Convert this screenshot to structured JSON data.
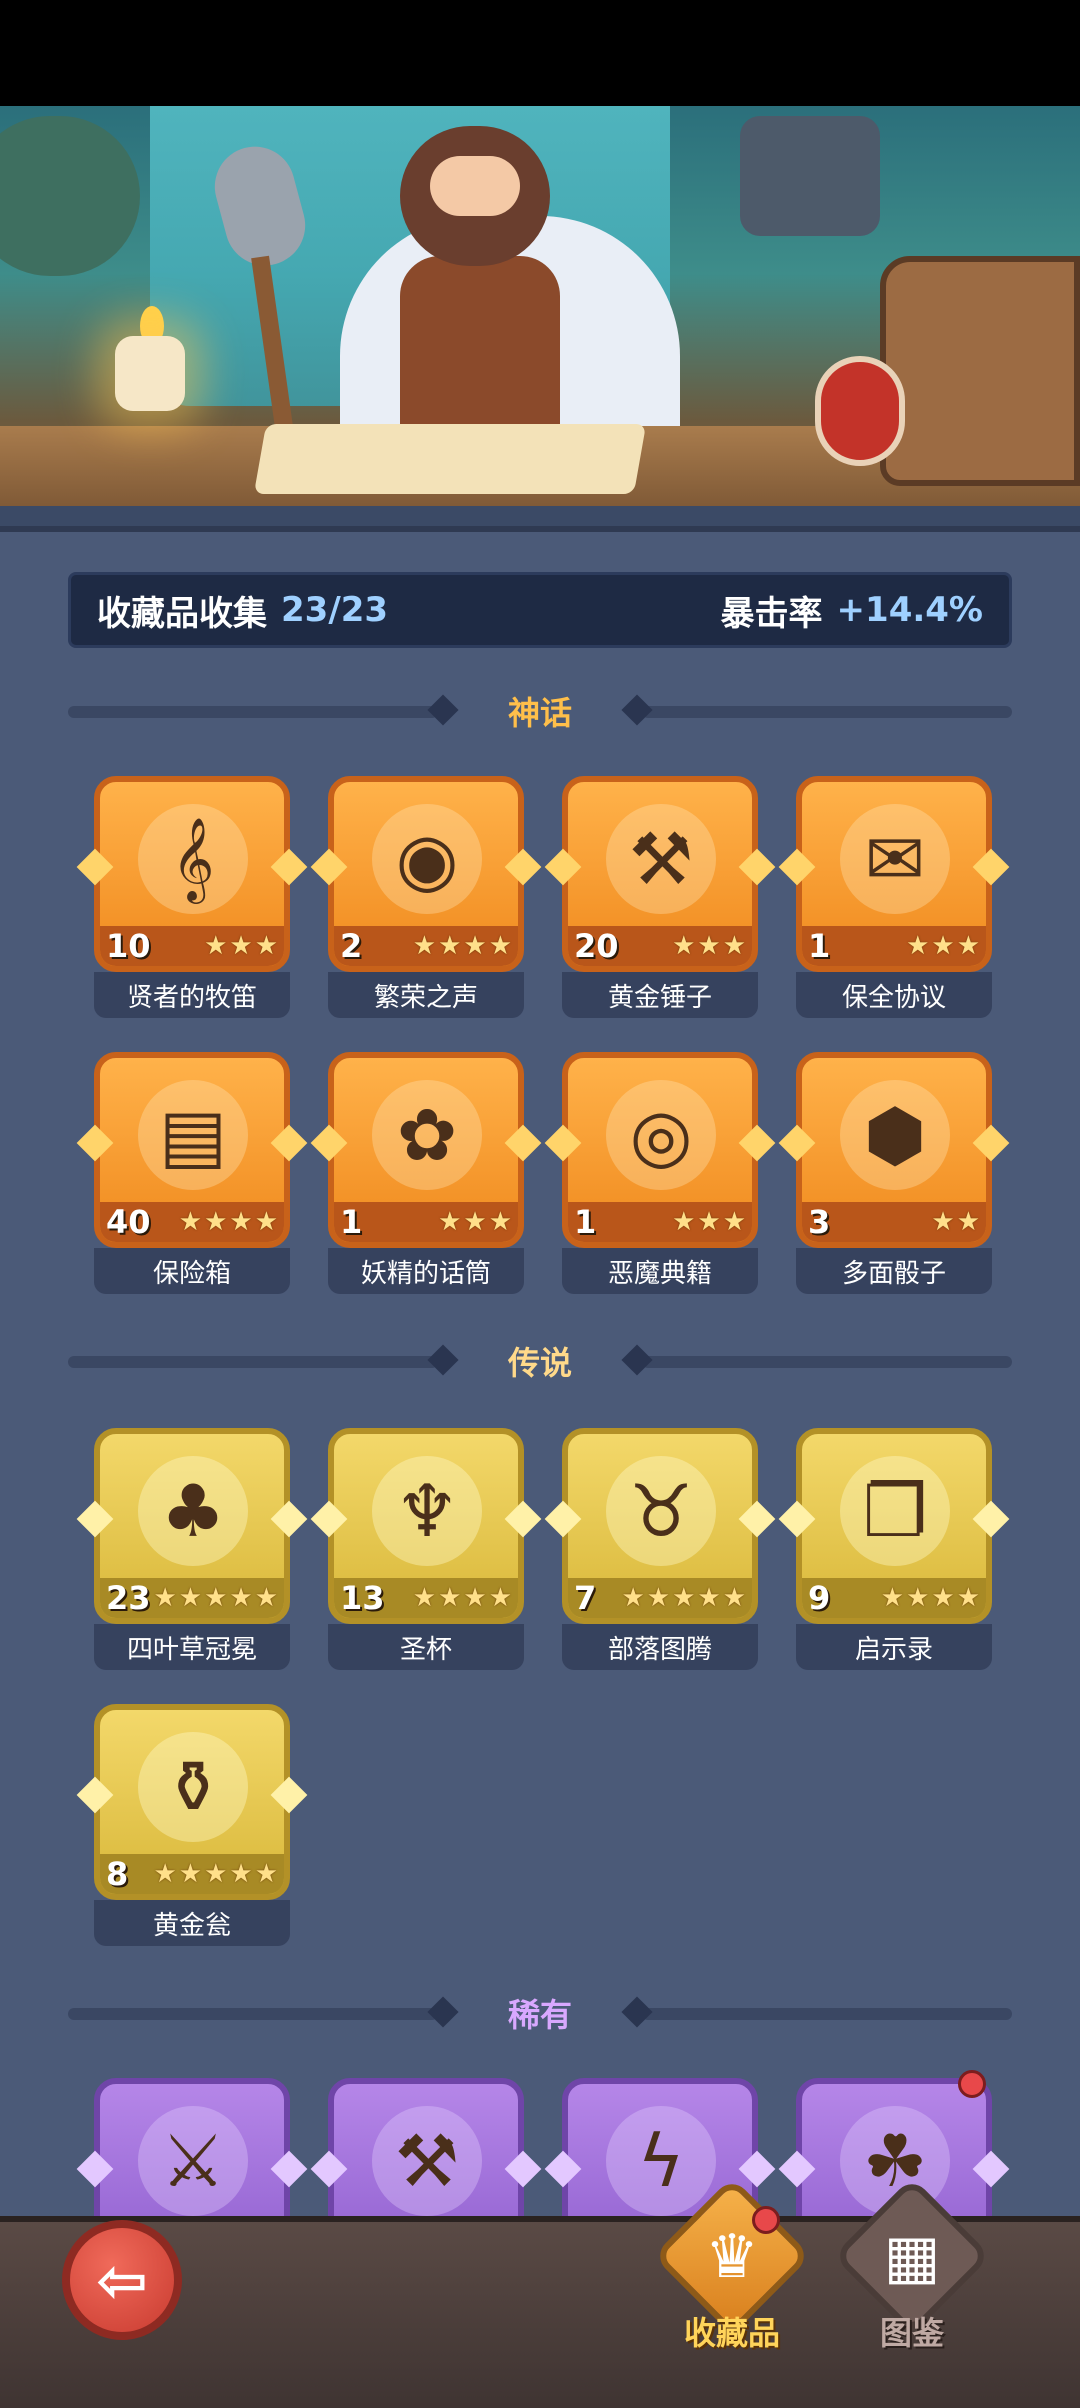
{
  "stats": {
    "collection_label": "收藏品收集",
    "collection_value": "23/23",
    "crit_label": "暴击率",
    "crit_value": "+14.4%"
  },
  "colors": {
    "mythic": "#f39b2e",
    "legendary": "#e2c24a",
    "rare": "#a276dc",
    "panel": "#4b5a78",
    "accent_blue": "#9fd0ff"
  },
  "sections": {
    "mythic": {
      "title": "神话",
      "color": "#ffbf4a"
    },
    "legendary": {
      "title": "传说",
      "color": "#ffd98a"
    },
    "rare": {
      "title": "稀有",
      "color": "#d9a8ff"
    }
  },
  "items": {
    "mythic": [
      {
        "name": "贤者的牧笛",
        "level": "10",
        "stars": 3,
        "icon": "flute-icon",
        "glyph": "𝄞"
      },
      {
        "name": "繁荣之声",
        "level": "2",
        "stars": 4,
        "icon": "orb-icon",
        "glyph": "◉"
      },
      {
        "name": "黄金锤子",
        "level": "20",
        "stars": 3,
        "icon": "hammer-icon",
        "glyph": "⚒"
      },
      {
        "name": "保全协议",
        "level": "1",
        "stars": 3,
        "icon": "scroll-icon",
        "glyph": "✉"
      },
      {
        "name": "保险箱",
        "level": "40",
        "stars": 4,
        "icon": "chest-icon",
        "glyph": "▤"
      },
      {
        "name": "妖精的话筒",
        "level": "1",
        "stars": 3,
        "icon": "fairy-icon",
        "glyph": "✿"
      },
      {
        "name": "恶魔典籍",
        "level": "1",
        "stars": 3,
        "icon": "eye-book-icon",
        "glyph": "◎"
      },
      {
        "name": "多面骰子",
        "level": "3",
        "stars": 2,
        "icon": "dice-icon",
        "glyph": "⬢"
      }
    ],
    "legendary": [
      {
        "name": "四叶草冠冕",
        "level": "23",
        "stars": 5,
        "icon": "clover-crown-icon",
        "glyph": "♣"
      },
      {
        "name": "圣杯",
        "level": "13",
        "stars": 4,
        "icon": "chalice-icon",
        "glyph": "♆"
      },
      {
        "name": "部落图腾",
        "level": "7",
        "stars": 5,
        "icon": "totem-icon",
        "glyph": "♉"
      },
      {
        "name": "启示录",
        "level": "9",
        "stars": 4,
        "icon": "book-icon",
        "glyph": "❐"
      },
      {
        "name": "黄金瓮",
        "level": "8",
        "stars": 5,
        "icon": "urn-icon",
        "glyph": "⚱"
      }
    ],
    "rare": [
      {
        "icon": "ice-sword-icon",
        "glyph": "⚔"
      },
      {
        "icon": "axe-icon",
        "glyph": "⚒"
      },
      {
        "icon": "rune-stone-icon",
        "glyph": "ϟ"
      },
      {
        "icon": "vine-icon",
        "glyph": "☘"
      }
    ]
  },
  "nav": {
    "back_glyph": "⇦",
    "tab_collection": "收藏品",
    "tab_codex": "图鉴",
    "collection_glyph": "♛",
    "codex_glyph": "▦"
  }
}
